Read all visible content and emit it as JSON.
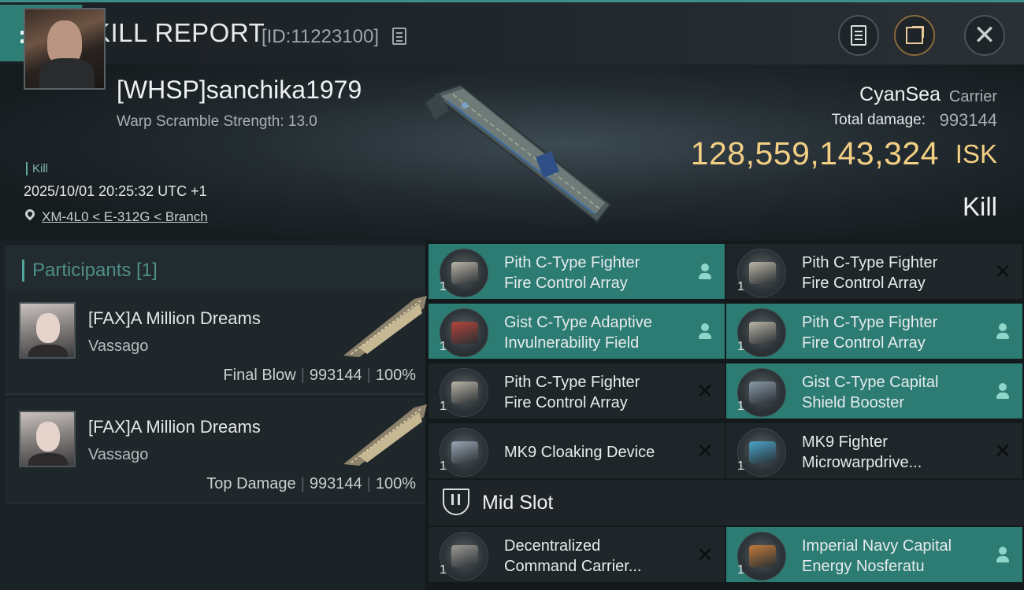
{
  "header": {
    "title": "KILL REPORT",
    "report_id": "[ID:11223100]"
  },
  "victim": {
    "pilot": "[WHSP]sanchika1979",
    "warp_scramble": "Warp Scramble Strength: 13.0",
    "kill_tag": "Kill",
    "datetime": "2025/10/01 20:25:32 UTC +1",
    "location": "XM-4L0 < E-312G < Branch",
    "ship_name": "CyanSea",
    "ship_class": "Carrier",
    "total_damage_label": "Total damage:",
    "total_damage": "993144",
    "isk_value": "128,559,143,324",
    "isk_unit": "ISK",
    "result": "Kill"
  },
  "participants": {
    "title": "Participants [1]",
    "items": [
      {
        "name": "[FAX]A Million Dreams",
        "ship": "Vassago",
        "role": "Final Blow",
        "damage": "993144",
        "percent": "100%"
      },
      {
        "name": "[FAX]A Million Dreams",
        "ship": "Vassago",
        "role": "Top Damage",
        "damage": "993144",
        "percent": "100%"
      }
    ]
  },
  "modules": [
    {
      "line1": "Pith C-Type Fighter",
      "line2": "Fire Control Array",
      "qty": "1",
      "status": "dropped",
      "icon": "fighter-fire-control-icon",
      "color": "#b9b4a6"
    },
    {
      "line1": "Pith C-Type Fighter",
      "line2": "Fire Control Array",
      "qty": "1",
      "status": "destroyed",
      "icon": "fighter-fire-control-icon",
      "color": "#b9b4a6"
    },
    {
      "line1": "Gist C-Type Adaptive",
      "line2": "Invulnerability Field",
      "qty": "1",
      "status": "dropped",
      "icon": "invulnerability-shield-icon",
      "color": "#b5443b"
    },
    {
      "line1": "Pith C-Type Fighter",
      "line2": "Fire Control Array",
      "qty": "1",
      "status": "dropped",
      "icon": "fighter-fire-control-icon",
      "color": "#b9b4a6"
    },
    {
      "line1": "Pith C-Type Fighter",
      "line2": "Fire Control Array",
      "qty": "1",
      "status": "destroyed",
      "icon": "fighter-fire-control-icon",
      "color": "#b9b4a6"
    },
    {
      "line1": "Gist C-Type Capital",
      "line2": "Shield Booster",
      "qty": "1",
      "status": "dropped",
      "icon": "shield-booster-icon",
      "color": "#8a99a8"
    },
    {
      "line1": "MK9 Cloaking Device",
      "line2": "",
      "qty": "1",
      "status": "destroyed",
      "icon": "cloaking-device-icon",
      "color": "#9aa6b4"
    },
    {
      "line1": "MK9 Fighter",
      "line2": "Microwarpdrive...",
      "qty": "1",
      "status": "destroyed",
      "icon": "microwarpdrive-icon",
      "color": "#4aa3c9"
    },
    {
      "line1": "Decentralized",
      "line2": "Command Carrier...",
      "qty": "1",
      "status": "destroyed",
      "icon": "command-module-icon",
      "color": "#9c9a94"
    },
    {
      "line1": "Imperial Navy Capital",
      "line2": "Energy Nosferatu",
      "qty": "1",
      "status": "dropped",
      "icon": "energy-nosferatu-icon",
      "color": "#c27a3a"
    }
  ],
  "mid_slot": {
    "label": "Mid Slot"
  },
  "colors": {
    "accent": "#2d7f76",
    "isk": "#f3cf84",
    "dropped_row": "#2c7c73"
  }
}
